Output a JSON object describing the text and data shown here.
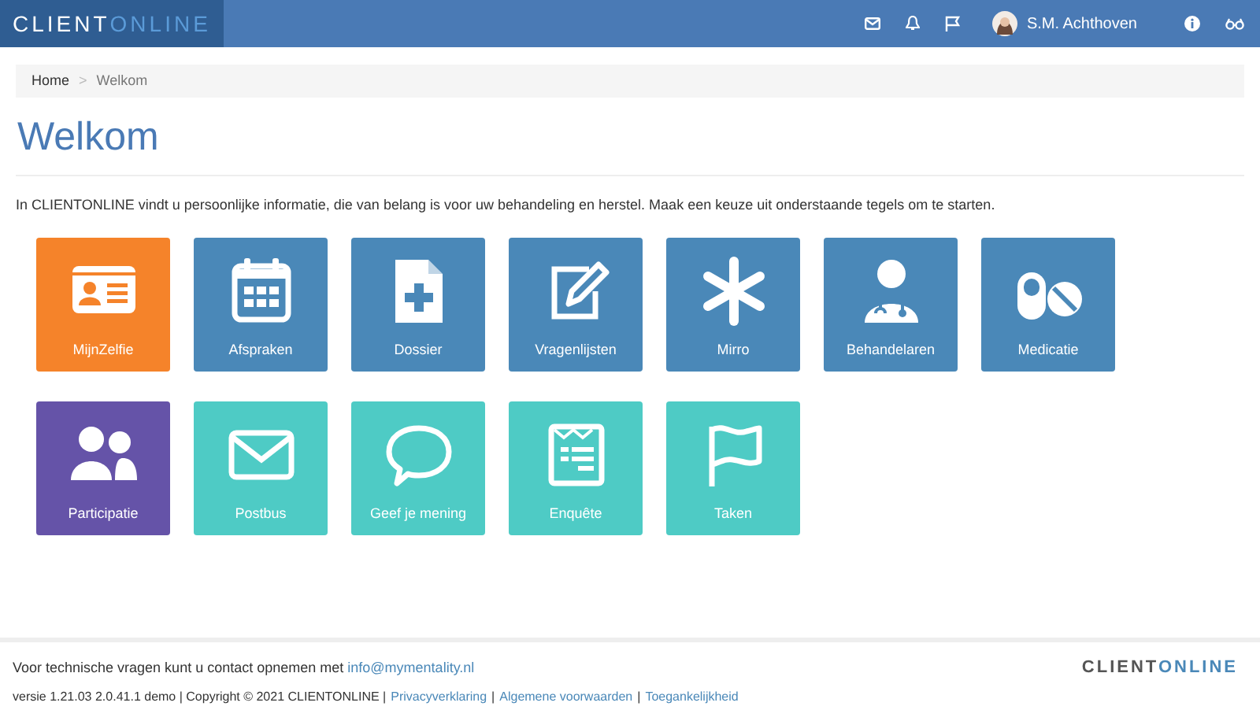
{
  "header": {
    "brand": "CLIENT",
    "brand_accent": "ONLINE",
    "user_name": "S.M. Achthoven"
  },
  "breadcrumb": [
    {
      "label": "Home",
      "kind": "link"
    },
    {
      "label": ">",
      "kind": "separator"
    },
    {
      "label": "Welkom",
      "kind": "current"
    }
  ],
  "title": "Welkom",
  "intro": "In CLIENTONLINE vindt u persoonlijke informatie, die van belang is voor uw behandeling en herstel. Maak een keuze uit onderstaande tegels om te starten.",
  "tile_rows": [
    [
      {
        "label": "MijnZelfie",
        "kind": "idcard",
        "color": "#f5832a"
      },
      {
        "label": "Afspraken",
        "kind": "calendar",
        "color": "#4a88b8"
      },
      {
        "label": "Dossier",
        "kind": "file",
        "color": "#4a88b8"
      },
      {
        "label": "Vragenlijsten",
        "kind": "edit",
        "color": "#4a88b8"
      },
      {
        "label": "Mirro",
        "kind": "asterisk",
        "color": "#4a88b8"
      },
      {
        "label": "Behandelaren",
        "kind": "doctor",
        "color": "#4a88b8"
      },
      {
        "label": "Medicatie",
        "kind": "pills",
        "color": "#4a88b8"
      }
    ],
    [
      {
        "label": "Participatie",
        "kind": "users",
        "color": "#6553a8"
      },
      {
        "label": "Postbus",
        "kind": "mail",
        "color": "#4ecbc5"
      },
      {
        "label": "Geef je mening",
        "kind": "chat",
        "color": "#4ecbc5"
      },
      {
        "label": "Enquête",
        "kind": "form",
        "color": "#4ecbc5"
      },
      {
        "label": "Taken",
        "kind": "flag",
        "color": "#4ecbc5"
      }
    ]
  ],
  "footer": {
    "contact_text": "Voor technische vragen kunt u contact opnemen met",
    "contact_email": "info@mymentality.nl",
    "brand": "CLIENT",
    "brand_accent": "ONLINE",
    "version_text": "versie 1.21.03 2.0.41.1 demo | Copyright © 2021 CLIENTONLINE |",
    "links": [
      {
        "label": "Privacyverklaring",
        "kind": "link"
      },
      {
        "label": "|",
        "kind": "separator"
      },
      {
        "label": "Algemene voorwaarden",
        "kind": "link"
      },
      {
        "label": "|",
        "kind": "separator"
      },
      {
        "label": "Toegankelijkheid",
        "kind": "link"
      }
    ]
  }
}
